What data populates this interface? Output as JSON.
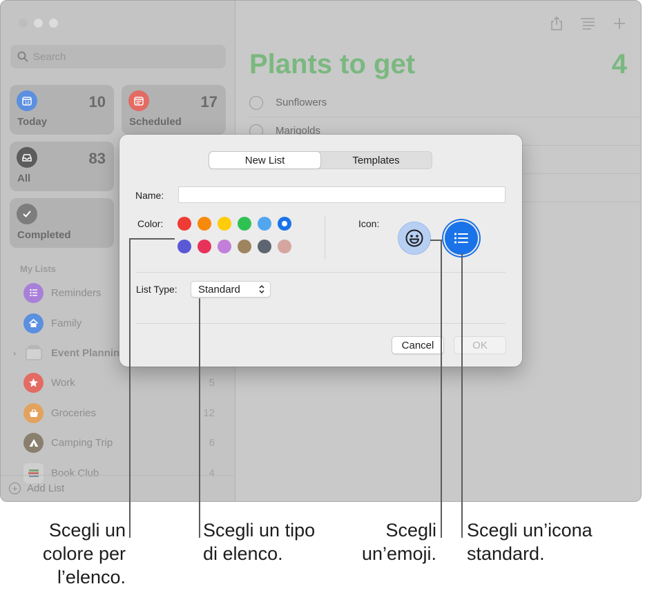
{
  "window": {
    "search_placeholder": "Search",
    "smart_lists": [
      {
        "label": "Today",
        "count": "10",
        "color": "#5b8fe0",
        "icon": "calendar-today-icon"
      },
      {
        "label": "Scheduled",
        "count": "17",
        "color": "#e36b63",
        "icon": "calendar-icon"
      },
      {
        "label": "All",
        "count": "83",
        "color": "#5c5c5c",
        "icon": "tray-icon"
      },
      {
        "label": "Completed",
        "count": "",
        "color": "#7d7d7d",
        "icon": "checkmark-icon"
      }
    ],
    "my_lists_header": "My Lists",
    "lists": [
      {
        "name": "Reminders",
        "count": "",
        "color": "#a880d9",
        "icon": "list-bullet-icon"
      },
      {
        "name": "Family",
        "count": "",
        "color": "#5b8fe0",
        "icon": "house-icon"
      },
      {
        "name": "Event Planning",
        "count": "",
        "color": "#b8b8b8",
        "icon": "stack-icon"
      },
      {
        "name": "Work",
        "count": "5",
        "color": "#e36b63",
        "icon": "star-icon"
      },
      {
        "name": "Groceries",
        "count": "12",
        "color": "#e3a35e",
        "icon": "basket-icon"
      },
      {
        "name": "Camping Trip",
        "count": "6",
        "color": "#8a7f6e",
        "icon": "tent-icon"
      },
      {
        "name": "Book Club",
        "count": "4",
        "color": "#cfcfcf",
        "icon": "book-emoji-icon"
      }
    ],
    "add_list_label": "Add List",
    "main_title": "Plants to get",
    "main_count": "4",
    "tasks": [
      "Sunflowers",
      "Marigolds"
    ]
  },
  "dialog": {
    "tabs": [
      {
        "label": "New List",
        "active": true
      },
      {
        "label": "Templates",
        "active": false
      }
    ],
    "name_label": "Name:",
    "name_value": "",
    "color_label": "Color:",
    "colors_row1": [
      "#ef3b35",
      "#f78a0c",
      "#fecc0b",
      "#2fc253",
      "#51a6ee",
      "#1a73e8"
    ],
    "colors_row2": [
      "#5b58d6",
      "#e83259",
      "#c17fd9",
      "#9f8460",
      "#5d6670",
      "#d5a69f"
    ],
    "selected_color": "#1a73e8",
    "icon_label": "Icon:",
    "icon_options": [
      "smiley-emoji-icon",
      "list-bullet-icon"
    ],
    "list_type_label": "List Type:",
    "list_type_value": "Standard",
    "cancel_label": "Cancel",
    "ok_label": "OK"
  },
  "callouts": [
    "Scegli un\ncolore per\nl’elenco.",
    "Scegli un tipo\ndi elenco.",
    "Scegli\nun’emoji.",
    "Scegli un’icona\nstandard."
  ]
}
